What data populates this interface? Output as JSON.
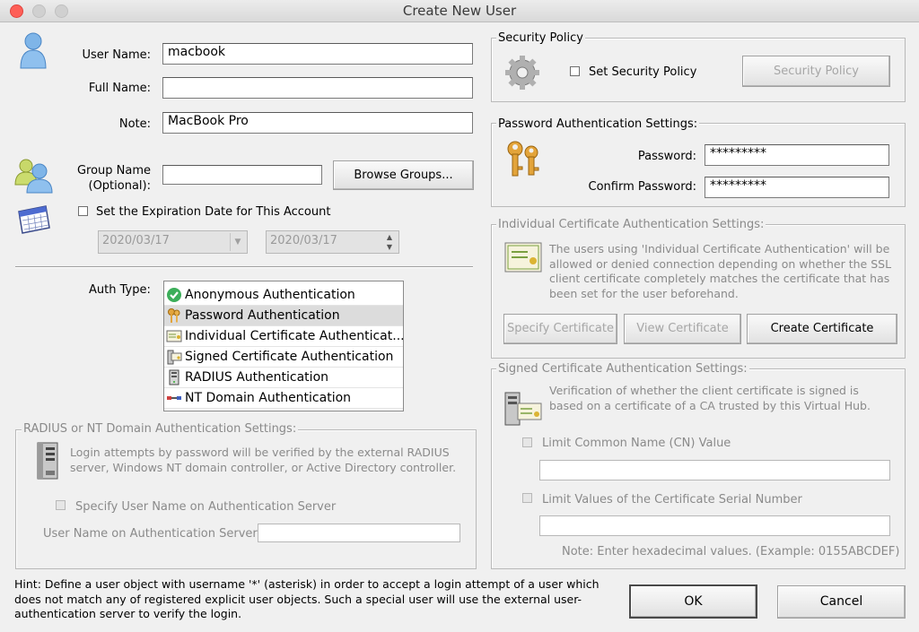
{
  "window": {
    "title": "Create New User"
  },
  "user": {
    "user_name_label": "User Name:",
    "user_name_value": "macbook",
    "full_name_label": "Full Name:",
    "full_name_value": "",
    "note_label": "Note:",
    "note_value": "MacBook Pro",
    "group_name_label_1": "Group Name",
    "group_name_label_2": "(Optional):",
    "group_name_value": "",
    "browse_groups_label": "Browse Groups...",
    "expiration_label": "Set the Expiration Date for This Account",
    "expiration_checked": false,
    "date_value": "2020/03/17",
    "time_value": "2020/03/17"
  },
  "auth_type": {
    "label": "Auth Type:",
    "items": [
      {
        "label": "Anonymous Authentication",
        "icon": "check-circle-icon",
        "selected": false
      },
      {
        "label": "Password Authentication",
        "icon": "keys-icon",
        "selected": true
      },
      {
        "label": "Individual Certificate Authenticat...",
        "icon": "certificate-icon",
        "selected": false
      },
      {
        "label": "Signed Certificate Authentication",
        "icon": "signed-certificate-icon",
        "selected": false
      },
      {
        "label": "RADIUS Authentication",
        "icon": "server-icon",
        "selected": false
      },
      {
        "label": "NT Domain Authentication",
        "icon": "network-icon",
        "selected": false
      }
    ]
  },
  "radius": {
    "group_label": "RADIUS or NT Domain Authentication Settings:",
    "description": "Login attempts by password will be verified by the external RADIUS server, Windows NT domain controller, or Active Directory controller.",
    "specify_label": "Specify User Name on Authentication Server",
    "username_label": "User Name on Authentication Server:",
    "username_value": ""
  },
  "security_policy": {
    "group_label": "Security Policy",
    "checkbox_label": "Set Security Policy",
    "checked": false,
    "button_label": "Security Policy"
  },
  "password": {
    "group_label": "Password Authentication Settings:",
    "password_label": "Password:",
    "password_value": "*********",
    "confirm_label": "Confirm Password:",
    "confirm_value": "*********"
  },
  "individual_cert": {
    "group_label": "Individual Certificate Authentication Settings:",
    "description": "The users using 'Individual Certificate Authentication' will be allowed or denied connection depending on whether the SSL client certificate completely matches the certificate that has been set for the user beforehand.",
    "specify_label": "Specify Certificate",
    "view_label": "View Certificate",
    "create_label": "Create Certificate"
  },
  "signed_cert": {
    "group_label": "Signed Certificate Authentication Settings:",
    "description": "Verification of whether the client certificate is signed is based on a certificate of a CA trusted by this Virtual Hub.",
    "cn_label": "Limit Common Name (CN) Value",
    "cn_value": "",
    "serial_label": "Limit Values of the Certificate Serial Number",
    "serial_value": "",
    "note": "Note: Enter hexadecimal values. (Example: 0155ABCDEF)"
  },
  "hint": "Hint: Define a user object with username '*' (asterisk) in order to accept a login attempt of a user which does not match any of registered explicit user objects. Such a special user will use the external user-authentication server to verify the login.",
  "buttons": {
    "ok_label": "OK",
    "cancel_label": "Cancel"
  }
}
